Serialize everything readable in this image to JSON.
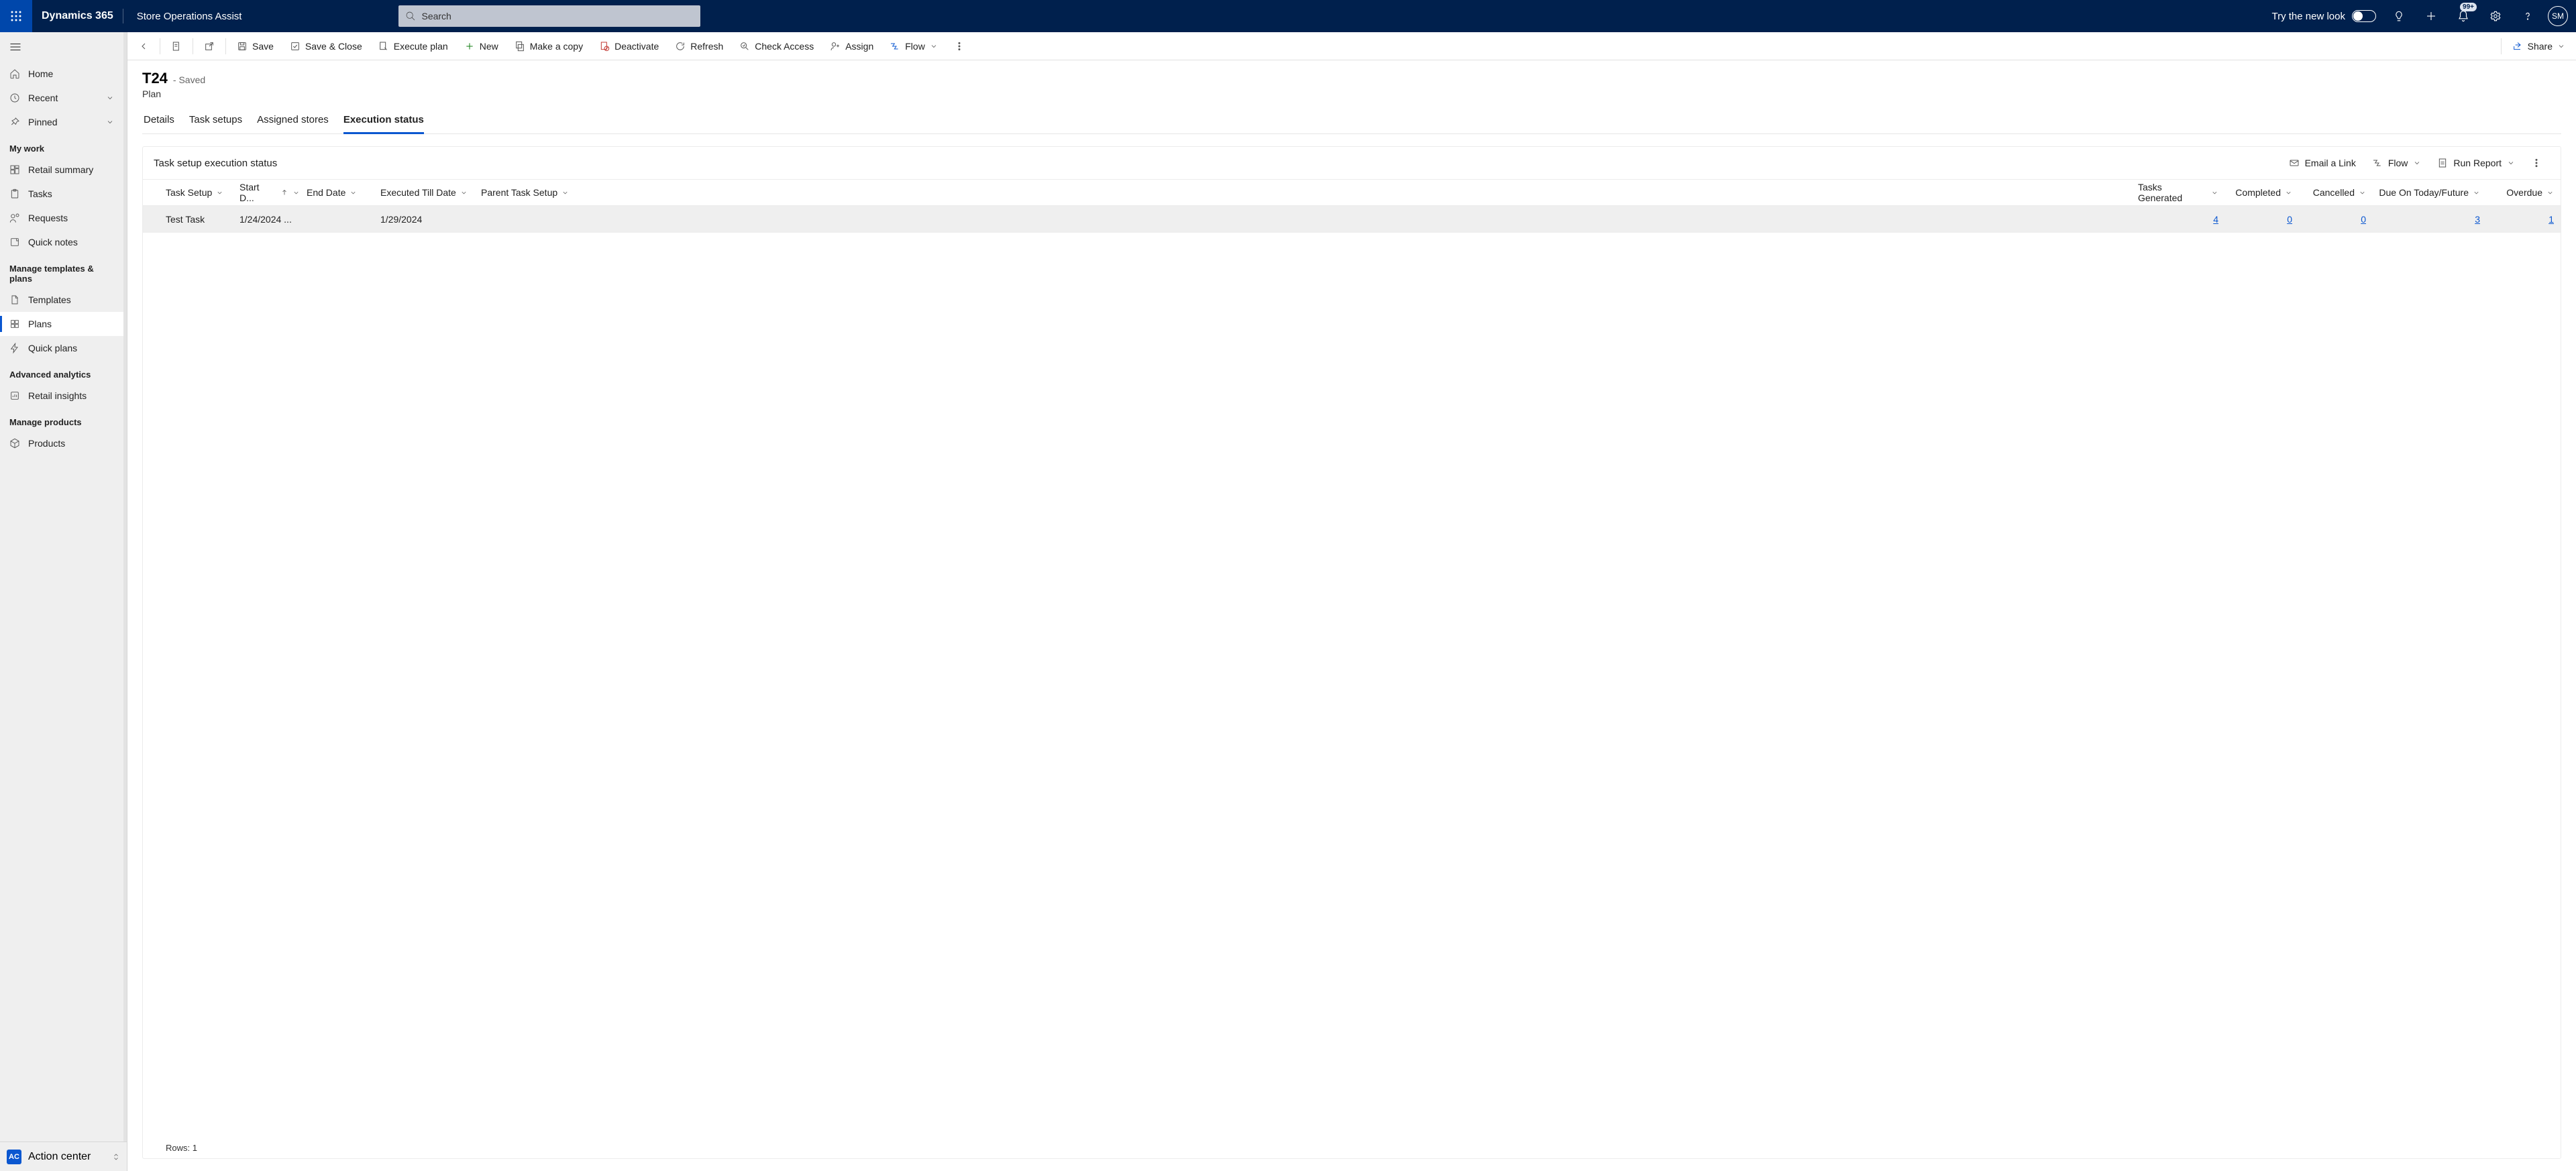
{
  "topbar": {
    "brand": "Dynamics 365",
    "app_name": "Store Operations Assist",
    "search_placeholder": "Search",
    "try_new_look": "Try the new look",
    "notification_badge": "99+",
    "avatar_initials": "SM"
  },
  "leftnav": {
    "home": "Home",
    "recent": "Recent",
    "pinned": "Pinned",
    "section_mywork": "My work",
    "retail_summary": "Retail summary",
    "tasks": "Tasks",
    "requests": "Requests",
    "quick_notes": "Quick notes",
    "section_templates": "Manage templates & plans",
    "templates": "Templates",
    "plans": "Plans",
    "quick_plans": "Quick plans",
    "section_analytics": "Advanced analytics",
    "retail_insights": "Retail insights",
    "section_products": "Manage products",
    "products": "Products",
    "area_badge": "AC",
    "area_label": "Action center"
  },
  "cmdbar": {
    "save": "Save",
    "save_close": "Save & Close",
    "execute": "Execute plan",
    "new": "New",
    "copy": "Make a copy",
    "deactivate": "Deactivate",
    "refresh": "Refresh",
    "check_access": "Check Access",
    "assign": "Assign",
    "flow": "Flow",
    "share": "Share"
  },
  "record": {
    "title": "T24",
    "state": "- Saved",
    "entity": "Plan"
  },
  "tabs": {
    "details": "Details",
    "task_setups": "Task setups",
    "assigned_stores": "Assigned stores",
    "execution_status": "Execution status"
  },
  "panel": {
    "title": "Task setup execution status",
    "email_link": "Email a Link",
    "flow": "Flow",
    "run_report": "Run Report"
  },
  "columns": {
    "task_setup": "Task Setup",
    "start_date": "Start D...",
    "end_date": "End Date",
    "executed_till": "Executed Till Date",
    "parent": "Parent Task Setup",
    "generated": "Tasks Generated",
    "completed": "Completed",
    "cancelled": "Cancelled",
    "due": "Due On Today/Future",
    "overdue": "Overdue"
  },
  "rows": [
    {
      "task_setup": "Test Task",
      "start_date": "1/24/2024 ...",
      "end_date": "",
      "executed_till": "1/29/2024",
      "parent": "",
      "generated": "4",
      "completed": "0",
      "cancelled": "0",
      "due": "3",
      "overdue": "1"
    }
  ],
  "footer": {
    "rows_label": "Rows: 1"
  }
}
